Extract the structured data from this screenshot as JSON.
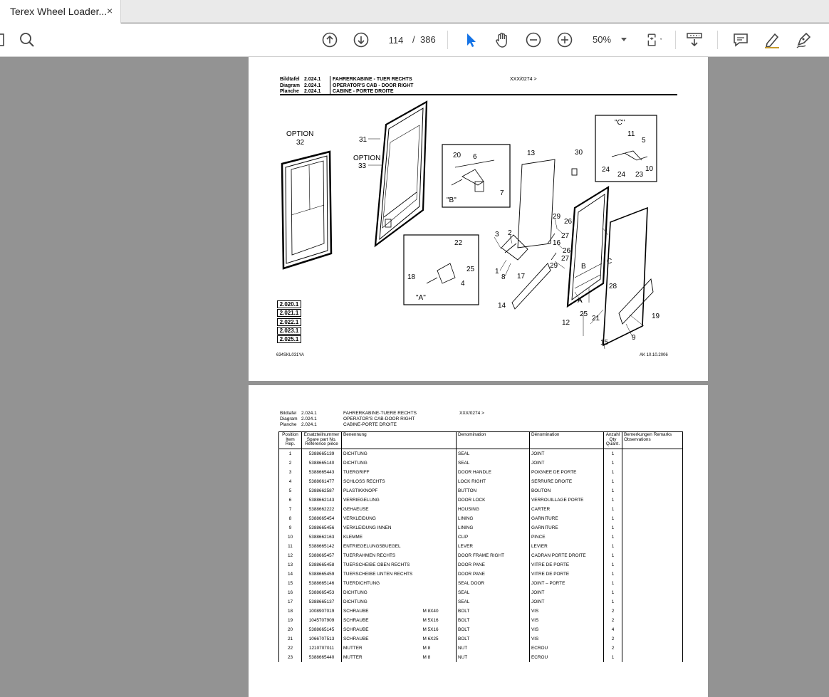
{
  "tab": {
    "title": "Terex Wheel Loader...",
    "close": "×"
  },
  "toolbar": {
    "page_current": "114",
    "page_sep": "/",
    "page_total": "386",
    "zoom": "50%"
  },
  "page1": {
    "header": {
      "rows": [
        {
          "k": "Bildtafel",
          "n": "2.024.1",
          "t": "FAHRERKABINE - TUER RECHTS"
        },
        {
          "k": "Diagram",
          "n": "2.024.1",
          "t": "OPERATOR'S CAB - DOOR RIGHT"
        },
        {
          "k": "Planche",
          "n": "2.024.1",
          "t": "CABINE  - PORTE DROITE"
        }
      ],
      "serial": "XXX/0274 >"
    },
    "refs": [
      "2.020.1",
      "2.021.1",
      "2.022.1",
      "2.023.1",
      "2.025.1"
    ],
    "footer_left": "634SKL031YA",
    "footer_right": "AK  10.10.2006",
    "labels": {
      "option": "OPTION",
      "n32": "32",
      "n31": "31",
      "n33": "33",
      "n20": "20",
      "n6": "6",
      "n7": "7",
      "b": "\"B\"",
      "n13": "13",
      "n30": "30",
      "c": "\"C\"",
      "n11": "11",
      "n5": "5",
      "n24": "24",
      "n23": "23",
      "n10": "10",
      "n22": "22",
      "n25": "25",
      "n18": "18",
      "n4": "4",
      "a": "\"A\"",
      "n3": "3",
      "n2": "2",
      "n1": "1",
      "n8": "8",
      "n17": "17",
      "n14": "14",
      "n29": "29",
      "n28": "28",
      "n27": "27",
      "n16": "16",
      "n26": "26",
      "letterB": "B",
      "letterC": "C",
      "letterA": "A",
      "n21": "21",
      "n12": "12",
      "n15": "15",
      "n9": "9",
      "n19": "19"
    }
  },
  "page2": {
    "header": {
      "rows": [
        {
          "k": "Bildtafel",
          "n": "2.024.1",
          "t": "FAHRERKABINE-TUERE RECHTS"
        },
        {
          "k": "Diagram",
          "n": "2.024.1",
          "t": "OPERATOR'S CAB-DOOR RIGHT"
        },
        {
          "k": "Planche",
          "n": "2.024.1",
          "t": "CABINE-PORTE DROITE"
        }
      ],
      "serial": "XXX/0274 >"
    },
    "columns": {
      "pos": "Position Item Rep.",
      "part": "Ersatzteilnummer Spare part No. Référence pièce",
      "benennung": "Benennung",
      "denomination_en": "Denomination",
      "denomination_fr": "Dénomination",
      "qty": "Anzahl Qty Quant.",
      "remarks": "Bemerkungen Remarks Observations"
    },
    "rows": [
      {
        "pos": "1",
        "part": "5388665139",
        "de": "DICHTUNG",
        "spec": "",
        "en": "SEAL",
        "fr": "JOINT",
        "qty": "1"
      },
      {
        "pos": "2",
        "part": "5388665140",
        "de": "DICHTUNG",
        "spec": "",
        "en": "SEAL",
        "fr": "JOINT",
        "qty": "1"
      },
      {
        "pos": "3",
        "part": "5388665443",
        "de": "TUERGRIFF",
        "spec": "",
        "en": "DOOR HANDLE",
        "fr": "POIGNEE DE PORTE",
        "qty": "1"
      },
      {
        "pos": "4",
        "part": "5388661477",
        "de": "SCHLOSS RECHTS",
        "spec": "",
        "en": "LOCK RIGHT",
        "fr": "SERRURE DROITE",
        "qty": "1"
      },
      {
        "pos": "5",
        "part": "5388662587",
        "de": "PLASTIKKNOPF",
        "spec": "",
        "en": "BUTTON",
        "fr": "BOUTON",
        "qty": "1"
      },
      {
        "pos": "6",
        "part": "5388662143",
        "de": "VERRIEGELUNG",
        "spec": "",
        "en": "DOOR LOCK",
        "fr": "VERROUILLAGE PORTE",
        "qty": "1"
      },
      {
        "pos": "7",
        "part": "5388662222",
        "de": "GEHAEUSE",
        "spec": "",
        "en": "HOUSING",
        "fr": "CARTER",
        "qty": "1"
      },
      {
        "pos": "8",
        "part": "5388665454",
        "de": "VERKLEIDUNG",
        "spec": "",
        "en": "LINING",
        "fr": "GARNITURE",
        "qty": "1"
      },
      {
        "pos": "9",
        "part": "5388665456",
        "de": "VERKLEIDUNG INNEN",
        "spec": "",
        "en": "LINING",
        "fr": "GARNITURE",
        "qty": "1"
      },
      {
        "pos": "10",
        "part": "5388662163",
        "de": "KLEMME",
        "spec": "",
        "en": "CLIP",
        "fr": "PINCE",
        "qty": "1"
      },
      {
        "pos": "11",
        "part": "5388665142",
        "de": "ENTRIEGELUNGSBUEGEL",
        "spec": "",
        "en": "LEVER",
        "fr": "LEVIER",
        "qty": "1"
      },
      {
        "pos": "12",
        "part": "5388665457",
        "de": "TUERRAHMEN RECHTS",
        "spec": "",
        "en": "DOOR FRAME RIGHT",
        "fr": "CADRAN PORTE DROITE",
        "qty": "1"
      },
      {
        "pos": "13",
        "part": "5388665458",
        "de": "TUERSCHEIBE OBEN RECHTS",
        "spec": "",
        "en": "DOOR PANE",
        "fr": "VITRE DE PORTE",
        "qty": "1"
      },
      {
        "pos": "14",
        "part": "5388665459",
        "de": "TUERSCHEIBE UNTEN RECHTS",
        "spec": "",
        "en": "DOOR PANE",
        "fr": "VITRE DE PORTE",
        "qty": "1"
      },
      {
        "pos": "15",
        "part": "5388665146",
        "de": "TUERDICHTUNG",
        "spec": "",
        "en": "SEAL DOOR",
        "fr": "JOINT – PORTE",
        "qty": "1"
      },
      {
        "pos": "16",
        "part": "5388665453",
        "de": "DICHTUNG",
        "spec": "",
        "en": "SEAL",
        "fr": "JOINT",
        "qty": "1"
      },
      {
        "pos": "17",
        "part": "5388665137",
        "de": "DICHTUNG",
        "spec": "",
        "en": "SEAL",
        "fr": "JOINT",
        "qty": "1"
      },
      {
        "pos": "18",
        "part": "1008907019",
        "de": "SCHRAUBE",
        "spec": "M 8X40",
        "en": "BOLT",
        "fr": "VIS",
        "qty": "2"
      },
      {
        "pos": "19",
        "part": "1045707909",
        "de": "SCHRAUBE",
        "spec": "M 5X16",
        "en": "BOLT",
        "fr": "VIS",
        "qty": "2"
      },
      {
        "pos": "20",
        "part": "5388665145",
        "de": "SCHRAUBE",
        "spec": "M 5X16",
        "en": "BOLT",
        "fr": "VIS",
        "qty": "4"
      },
      {
        "pos": "21",
        "part": "1066707513",
        "de": "SCHRAUBE",
        "spec": "M 6X25",
        "en": "BOLT",
        "fr": "VIS",
        "qty": "2"
      },
      {
        "pos": "22",
        "part": "1210707011",
        "de": "MUTTER",
        "spec": "M 8",
        "en": "NUT",
        "fr": "ECROU",
        "qty": "2"
      },
      {
        "pos": "23",
        "part": "5388665440",
        "de": "MUTTER",
        "spec": "M 8",
        "en": "NUT",
        "fr": "ECROU",
        "qty": "1"
      }
    ]
  }
}
